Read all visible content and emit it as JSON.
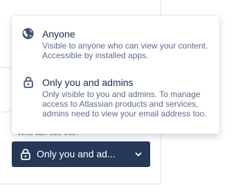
{
  "background": {
    "field_label": "Who can see this?"
  },
  "visibility_selector": {
    "selected_label": "Only you and ad...",
    "icon": "lock-icon",
    "chevron_icon": "chevron-down-icon"
  },
  "menu": {
    "options": [
      {
        "icon": "globe-icon",
        "title": "Anyone",
        "description": "Visible to anyone who can view your content. Accessible by installed apps."
      },
      {
        "icon": "lock-icon",
        "title": "Only you and admins",
        "description": "Only visible to you and admins. To manage access to Atlassian products and services, admins need to view your email address too."
      }
    ]
  },
  "colors": {
    "selector_bg": "#253858",
    "text_primary": "#172b4d",
    "text_secondary": "#5e6c84",
    "icon_gray": "#42526e"
  }
}
